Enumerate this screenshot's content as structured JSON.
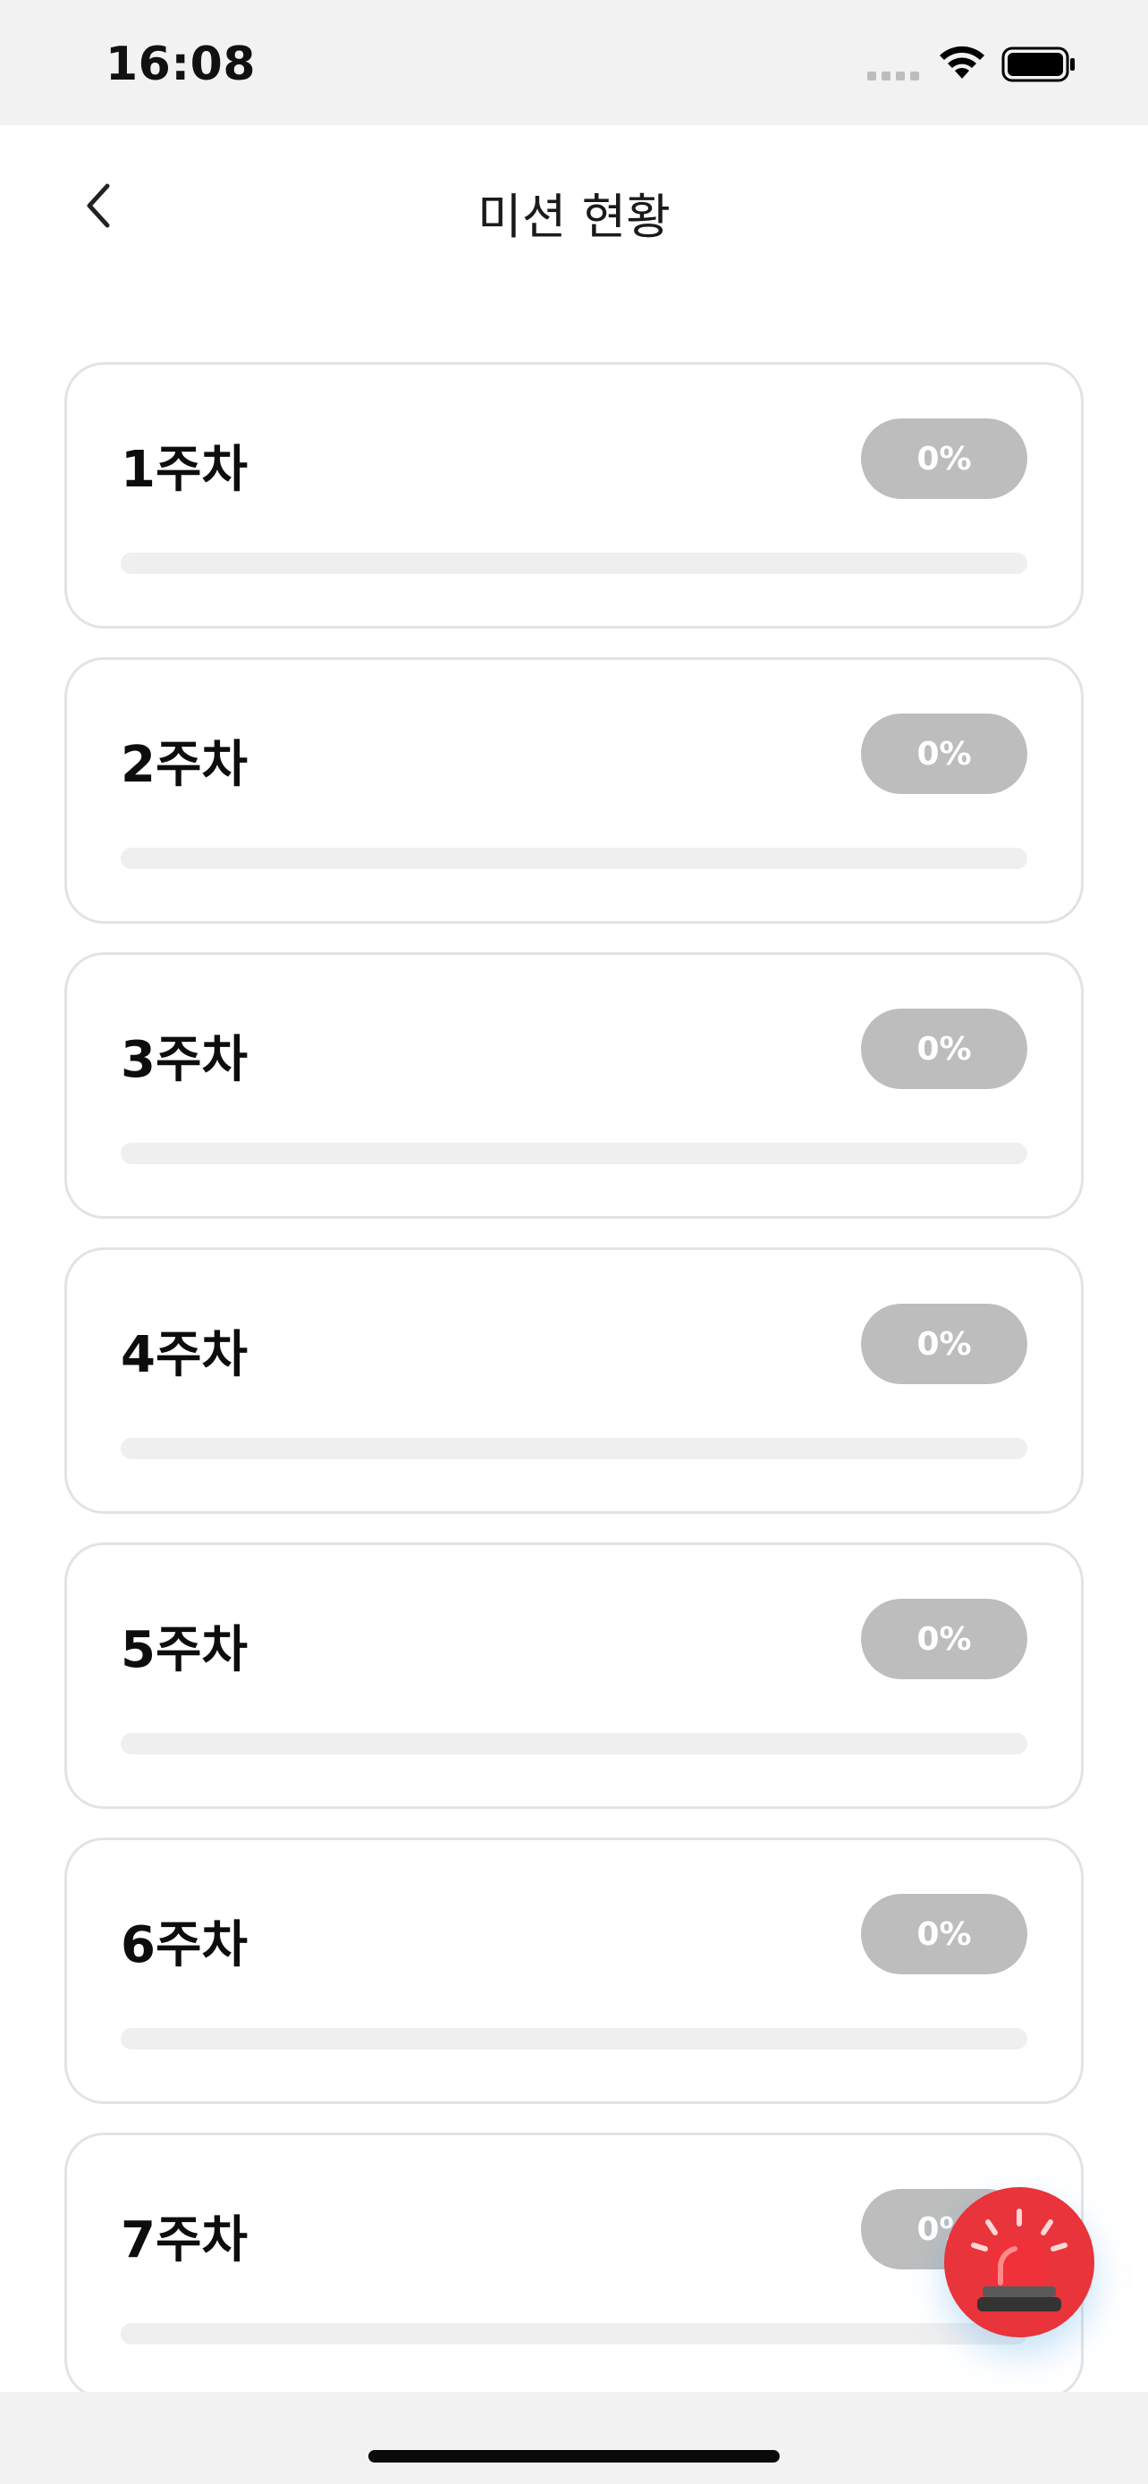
{
  "status_bar": {
    "time": "16:08"
  },
  "header": {
    "title": "미션 현황",
    "back_icon": "chevron-left-icon"
  },
  "weeks": [
    {
      "label": "1주차",
      "percent_text": "0%",
      "progress": 0
    },
    {
      "label": "2주차",
      "percent_text": "0%",
      "progress": 0
    },
    {
      "label": "3주차",
      "percent_text": "0%",
      "progress": 0
    },
    {
      "label": "4주차",
      "percent_text": "0%",
      "progress": 0
    },
    {
      "label": "5주차",
      "percent_text": "0%",
      "progress": 0
    },
    {
      "label": "6주차",
      "percent_text": "0%",
      "progress": 0
    },
    {
      "label": "7주차",
      "percent_text": "0%",
      "progress": 0
    }
  ],
  "floating_button": {
    "icon": "siren-icon",
    "color": "#e8343a"
  },
  "colors": {
    "badge": "#bdbdbd",
    "track": "#efefef",
    "card_border": "#e3e3e3"
  }
}
